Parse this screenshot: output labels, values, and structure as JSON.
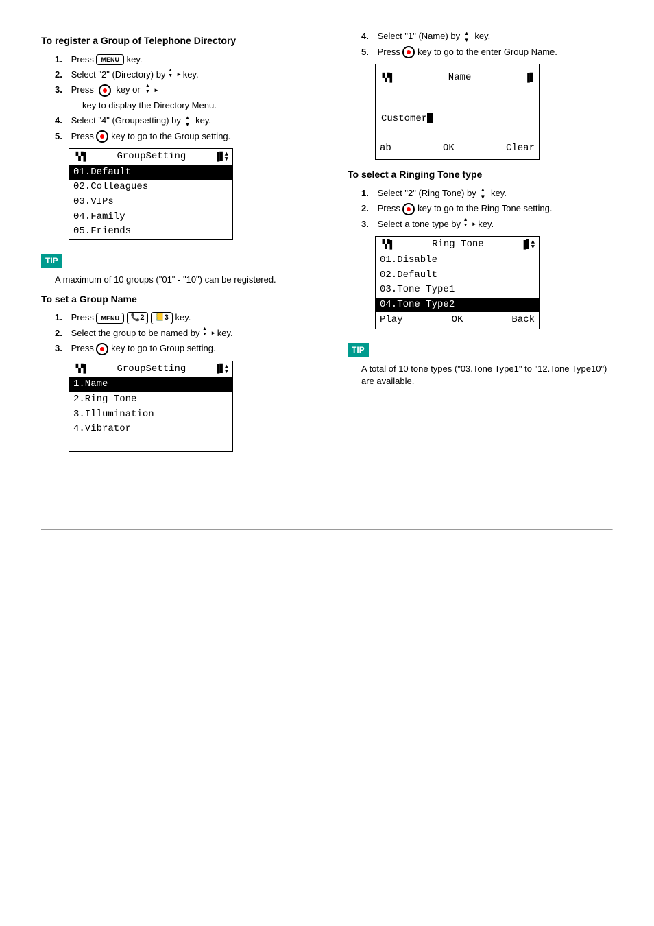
{
  "left": {
    "registerGroup": {
      "title": "To register a Group of Telephone Directory",
      "step1_num": "1.",
      "step1_a": "Press",
      "menu_btn": "MENU",
      "step1_b": "key.",
      "step2_num": "2.",
      "step2_a": "Select \"2\" (Directory) by",
      "step2_b": "key.",
      "step3_num": "3.",
      "step3_a": "Press         key or",
      "step3_b": "   key to display the Directory Menu.",
      "step4_num": "4.",
      "step4_a": "Select \"4\" (Groupsetting) by",
      "step4_b": " key.",
      "step5_num": "5.",
      "step5_a": "Press",
      "step5_b": "key to go to the Group setting."
    },
    "lcd1": {
      "title": "GroupSetting",
      "items": [
        "01.Default",
        "02.Colleagues",
        "03.VIPs",
        "04.Family",
        "05.Friends"
      ],
      "selected": 0
    },
    "tip1": {
      "label": "TIP",
      "text": "A maximum of 10 groups (\"01\" - \"10\") can be registered."
    },
    "groupName": {
      "title": "To set a Group Name",
      "step1_num": "1.",
      "step1_a": "Press",
      "menu_btn": "MENU",
      "key2": "2",
      "key3": "3",
      "step1_b": "key.",
      "step2_num": "2.",
      "step2_a": "Select the group to be named by",
      "step2_b": "key.",
      "step3_num": "3.",
      "step3_a": "Press",
      "step3_b": "key to go to Group setting."
    },
    "lcd2": {
      "title": "GroupSetting",
      "items": [
        "1.Name",
        "2.Ring Tone",
        "3.Illumination",
        "4.Vibrator"
      ],
      "selected": 0
    }
  },
  "right": {
    "nameStep": {
      "step4_num": "4.",
      "step4_a": "Select \"1\" (Name) by",
      "step4_b": "key.",
      "step5_num": "5.",
      "step5_a": "Press",
      "step5_b": "key to go to the enter Group Name."
    },
    "lcdName": {
      "title": "Name",
      "value": "Customer",
      "softkeys": {
        "left": "ab",
        "center": "OK",
        "right": "Clear"
      }
    },
    "ringTone": {
      "title": "To select a Ringing Tone type",
      "step1_num": "1.",
      "step1_a": "Select \"2\" (Ring Tone) by",
      "step1_b": "key.",
      "step2_num": "2.",
      "step2_a": "Press",
      "step2_b": "key to go to the Ring Tone setting.",
      "step3_num": "3.",
      "step3_a": "Select a tone type by",
      "step3_b": "key."
    },
    "lcdRing": {
      "title": "Ring Tone",
      "items": [
        "01.Disable",
        "02.Default",
        "03.Tone Type1",
        "04.Tone Type2"
      ],
      "selected": 3,
      "softkeys": {
        "left": "Play",
        "center": "OK",
        "right": "Back"
      }
    },
    "tip2": {
      "label": "TIP",
      "text": "A total of 10 tone types (\"03.Tone Type1\" to \"12.Tone Type10\") are available."
    }
  }
}
